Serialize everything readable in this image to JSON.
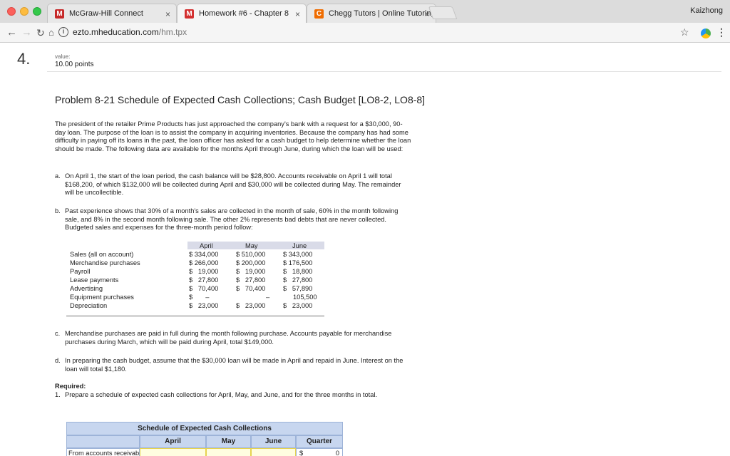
{
  "browser": {
    "tabs": [
      {
        "title": "McGraw-Hill Connect",
        "favicon": "M"
      },
      {
        "title": "Homework #6 - Chapter 8",
        "favicon": "M"
      },
      {
        "title": "Chegg Tutors | Online Tutoring",
        "favicon": "C"
      }
    ],
    "profile": "Kaizhong",
    "url_host": "ezto.mheducation.com",
    "url_path": "/hm.tpx"
  },
  "question": {
    "number": "4.",
    "value_label": "value:",
    "points": "10.00 points"
  },
  "problem": {
    "title": "Problem 8-21 Schedule of Expected Cash Collections; Cash Budget [LO8-2, LO8-8]",
    "intro": "The president of the retailer Prime Products has just approached the company's bank with a request for a $30,000, 90-day loan. The purpose of the loan is to assist the company in acquiring inventories. Because the company has had some difficulty in paying off its loans in the past, the loan officer has asked for a cash budget to help determine whether the loan should be made. The following data are available for the months April through June, during which the loan will be used:",
    "item_a_marker": "a.",
    "item_a": "On April 1, the start of the loan period, the cash balance will be $28,800. Accounts receivable on April 1 will total $168,200, of which $132,000 will be collected during April and $30,000 will be collected during May. The remainder will be uncollectible.",
    "item_b_marker": "b.",
    "item_b": "Past experience shows that 30% of a month's sales are collected in the month of sale, 60% in the month following sale, and 8% in the second month following sale. The other 2% represents bad debts that are never collected. Budgeted sales and expenses for the three-month period follow:",
    "item_c_marker": "c.",
    "item_c": "Merchandise purchases are paid in full during the month following purchase. Accounts payable for merchandise purchases during March, which will be paid during April, total $149,000.",
    "item_d_marker": "d.",
    "item_d": "In preparing the cash budget, assume that the $30,000 loan will be made in April and repaid in June. Interest on the loan will total $1,180.",
    "required_label": "Required:",
    "req_1_marker": "1.",
    "req_1": "Prepare a schedule of expected cash collections for April, May, and June, and for the three months in total."
  },
  "budget_table": {
    "months": [
      "April",
      "May",
      "June"
    ],
    "rows": [
      {
        "label": "Sales (all on account)",
        "values": [
          "$ 334,000",
          "$ 510,000",
          "$ 343,000"
        ]
      },
      {
        "label": "Merchandise purchases",
        "values": [
          "$ 266,000",
          "$ 200,000",
          "$ 176,500"
        ]
      },
      {
        "label": "Payroll",
        "values": [
          "$   19,000",
          "$   19,000",
          "$   18,800"
        ]
      },
      {
        "label": "Lease payments",
        "values": [
          "$   27,800",
          "$   27,800",
          "$   27,800"
        ]
      },
      {
        "label": "Advertising",
        "values": [
          "$   70,400",
          "$   70,400",
          "$   57,890"
        ]
      },
      {
        "label": "Equipment purchases",
        "values": [
          "$       –",
          "–",
          "105,500"
        ]
      },
      {
        "label": "Depreciation",
        "values": [
          "$   23,000",
          "$   23,000",
          "$   23,000"
        ]
      }
    ]
  },
  "schedule": {
    "title": "Schedule of Expected Cash Collections",
    "headers": [
      "April",
      "May",
      "June",
      "Quarter"
    ],
    "row_label": "From accounts receivable",
    "quarter_currency": "$",
    "quarter_value": "0"
  }
}
